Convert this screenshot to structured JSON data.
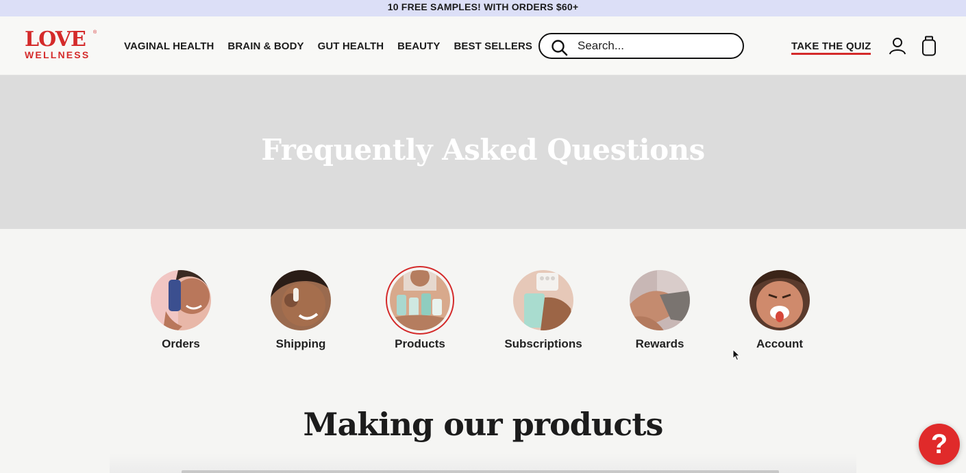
{
  "promo": {
    "text": "10 FREE SAMPLES! WITH ORDERS $60+"
  },
  "brand": {
    "line1": "LOVE",
    "line2": "WELLNESS",
    "reg": "®",
    "color": "#d42a2a"
  },
  "nav": {
    "items": [
      {
        "label": "VAGINAL HEALTH"
      },
      {
        "label": "BRAIN & BODY"
      },
      {
        "label": "GUT HEALTH"
      },
      {
        "label": "BEAUTY"
      },
      {
        "label": "BEST SELLERS"
      }
    ]
  },
  "search": {
    "placeholder": "Search..."
  },
  "header_actions": {
    "quiz_label": "TAKE THE QUIZ",
    "account_icon": "user-icon",
    "cart_icon": "bag-icon"
  },
  "hero": {
    "title": "Frequently Asked Questions",
    "bg": "#dcdcdc"
  },
  "categories": [
    {
      "label": "Orders",
      "active": false
    },
    {
      "label": "Shipping",
      "active": false
    },
    {
      "label": "Products",
      "active": true
    },
    {
      "label": "Subscriptions",
      "active": false
    },
    {
      "label": "Rewards",
      "active": false
    },
    {
      "label": "Account",
      "active": false
    }
  ],
  "section": {
    "title": "Making our products"
  },
  "help_button": {
    "label": "?",
    "color": "#e02a2a"
  }
}
